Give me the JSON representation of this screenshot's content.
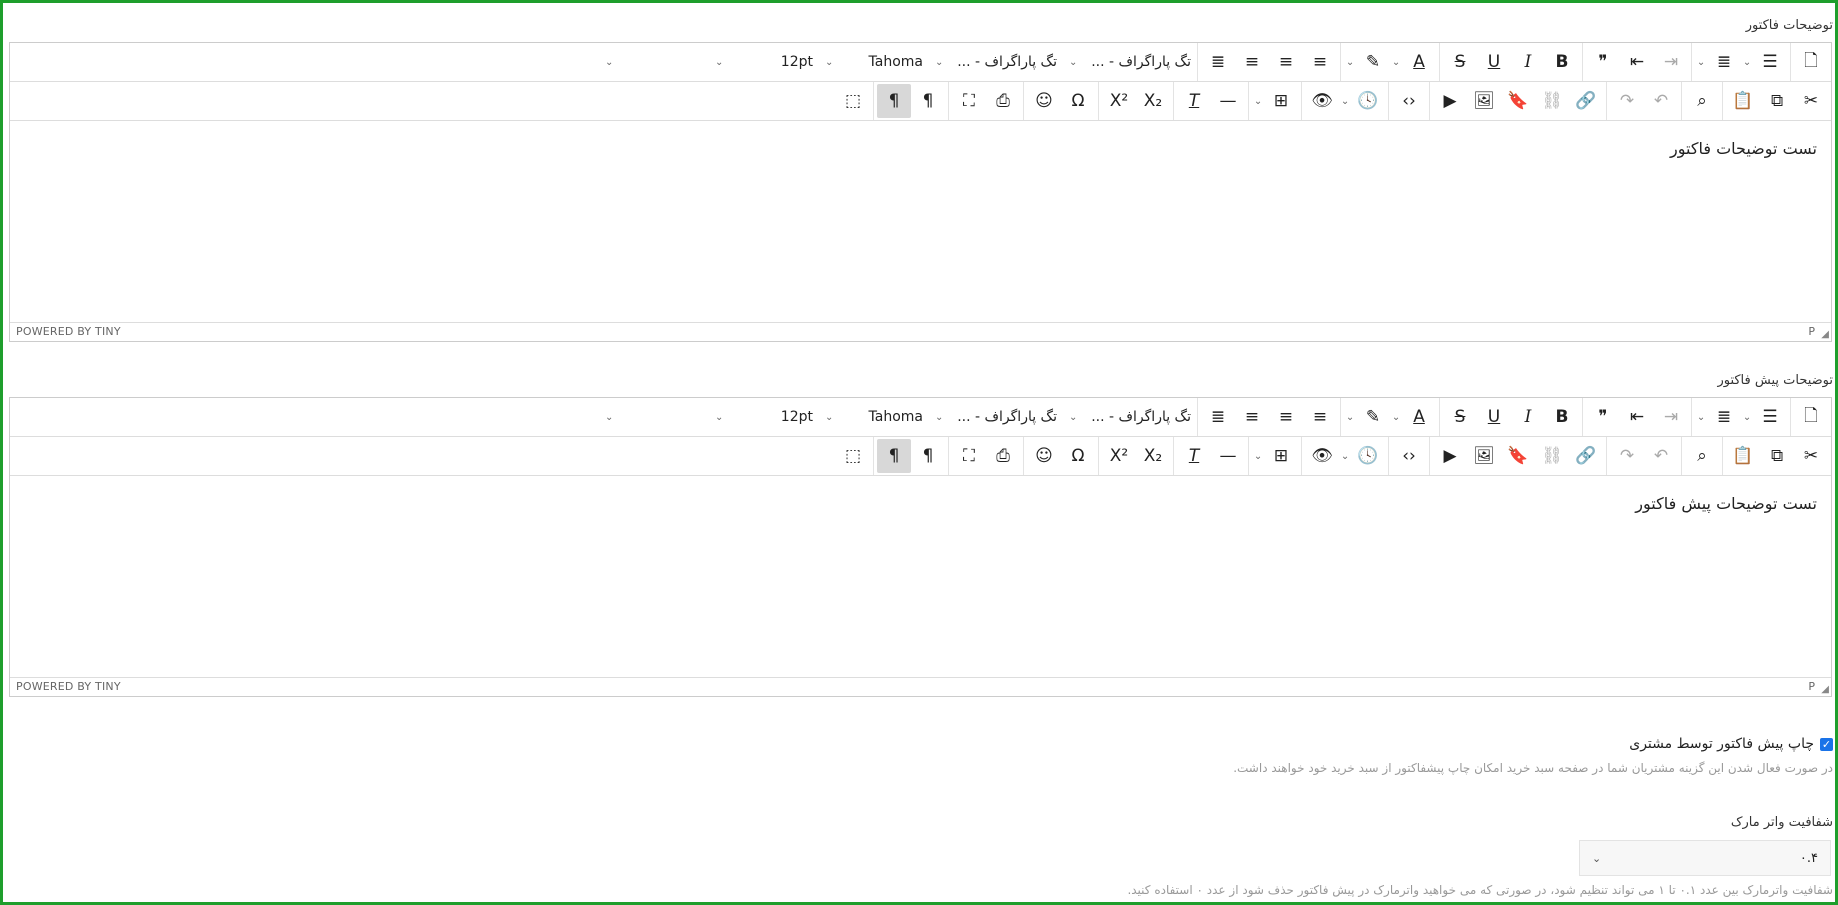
{
  "editors": [
    {
      "label": "توضیحات فاکتور",
      "content": "تست توضیحات فاکتور"
    },
    {
      "label": "توضیحات پیش فاکتور",
      "content": "تست توضیحات پیش فاکتور"
    }
  ],
  "toolbar": {
    "block_format_1": "تگ پاراگراف - ...",
    "block_format_2": "تگ پاراگراف - ...",
    "font_family": "Tahoma",
    "font_size": "12pt"
  },
  "statusbar": {
    "powered": "POWERED BY TINY",
    "path": "P"
  },
  "print_option": {
    "label": "چاپ پیش فاکتور توسط مشتری",
    "checked": true,
    "help": "در صورت فعال شدن این گزینه مشتریان شما در صفحه سبد خرید امکان چاپ پیشفاکتور از سبد خرید خود خواهند داشت."
  },
  "watermark": {
    "label": "شفافیت واتر مارک",
    "value": "۰.۴",
    "help": "شفافیت واترمارک بین عدد ۰.۱ تا ۱ می تواند تنظیم شود، در صورتی که می خواهید واترمارک در پیش فاکتور حذف شود از عدد ۰ استفاده کنید."
  },
  "colors": {
    "frame": "#1e9e2c",
    "checkbox": "#1a73e8"
  }
}
